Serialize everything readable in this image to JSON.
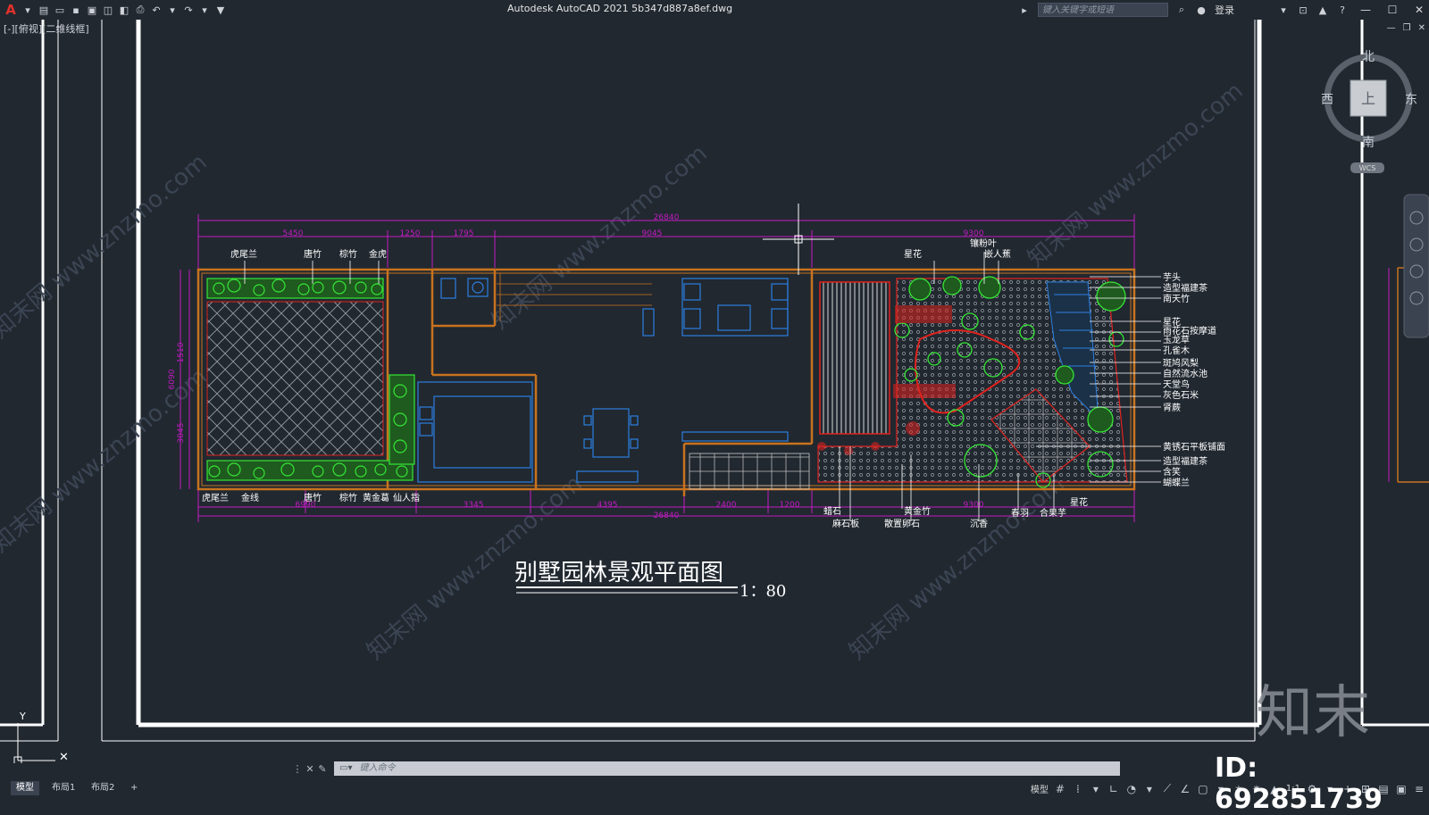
{
  "app": {
    "title": "Autodesk AutoCAD 2021    5b347d887a8ef.dwg",
    "logo_letter": "A",
    "search_placeholder": "键入关键字或短语",
    "login_label": "登录"
  },
  "viewport": {
    "label": "[-][俯视][二维线框]"
  },
  "viewcube": {
    "north": "北",
    "south": "南",
    "east": "东",
    "west": "西",
    "top": "上",
    "wcs": "WCS"
  },
  "drawing": {
    "title": "别墅园林景观平面图",
    "scale": "1：80",
    "dims_top": [
      "26840",
      "5450",
      "1250",
      "1795",
      "9045",
      "9300"
    ],
    "dims_bottom": [
      "26840",
      "6990",
      "3345",
      "4395",
      "2400",
      "1200",
      "9300"
    ],
    "dims_left": [
      "6090",
      "1510",
      "3045"
    ],
    "labels_top_left": [
      "虎尾兰",
      "唐竹",
      "棕竹",
      "金虎"
    ],
    "labels_bottom_left": [
      "虎尾兰",
      "金线",
      "唐竹",
      "棕竹",
      "黄金葛",
      "仙人指"
    ],
    "labels_top_right": [
      "星花",
      "镶粉叶",
      "嵌人蕉"
    ],
    "labels_right": [
      "芋头",
      "造型福建茶",
      "南天竹",
      "星花",
      "雨花石按摩道",
      "玉龙草",
      "孔雀木",
      "斑鸠风梨",
      "自然流水池",
      "天堂鸟",
      "灰色石米",
      "肾蕨",
      "黄锈石平板铺面",
      "造型福建茶",
      "含笑",
      "蝴蝶兰"
    ],
    "labels_bottom_right": [
      "星花",
      "蜡石",
      "麻石板",
      "黄金竹",
      "散置卵石",
      "沉香",
      "春羽",
      "合果芋"
    ]
  },
  "watermark": {
    "text": "知末网 www.znzmo.com",
    "brand": "知末",
    "id": "ID: 692851739"
  },
  "command": {
    "placeholder": "键入命令"
  },
  "layout_tabs": [
    "模型",
    "布局1",
    "布局2",
    "+"
  ],
  "status": {
    "model_label": "模型",
    "scale": "1:1"
  },
  "colors": {
    "background": "#212830",
    "wall": "#c8731e",
    "dimension": "#c21bc2",
    "plant": "#35e635",
    "furniture": "#2c7fe0",
    "red": "#e0221e"
  }
}
